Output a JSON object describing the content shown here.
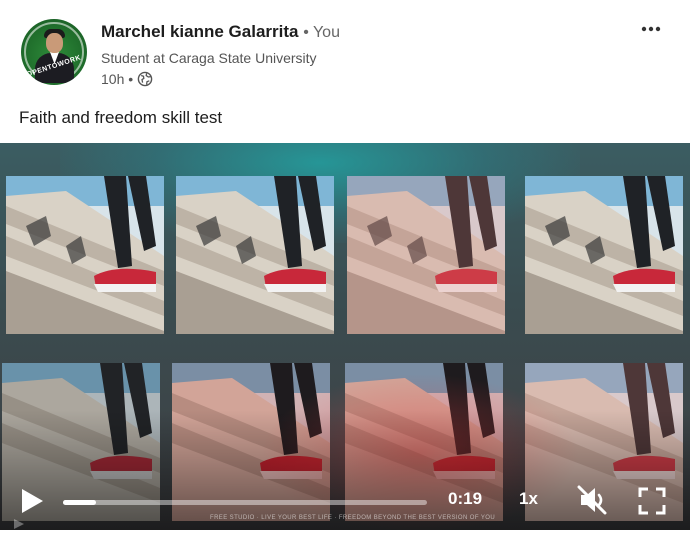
{
  "post": {
    "author_name": "Marchel kianne Galarrita",
    "author_relation": "• You",
    "author_headline": "Student at Caraga State University",
    "timestamp": "10h •",
    "visibility_icon": "globe-icon",
    "avatar_badge_text": "OPENTOWORK",
    "more_icon": "more-horizontal-icon",
    "text": "Faith and freedom skill test"
  },
  "video": {
    "progress": 0.09,
    "current_time": "0:19",
    "playback_speed": "1x",
    "play_icon": "play-icon",
    "mute_icon": "volume-muted-icon",
    "fullscreen_icon": "fullscreen-icon",
    "caption_text": "FREE STUDIO · LIVE YOUR BEST LIFE · FREEDOM BEYOND THE BEST VERSION OF YOU"
  },
  "colors": {
    "video_bg_top": "#3b5d62",
    "video_bg_bottom": "#3f3f42",
    "shoe_red": "#c8283a",
    "avatar_green": "#2e8b3a"
  }
}
